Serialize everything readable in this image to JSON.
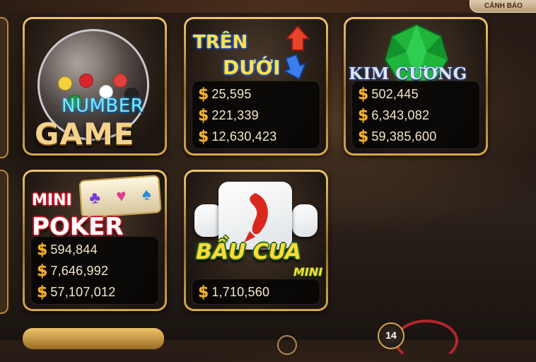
{
  "header": {
    "warning_button": "CẢNH BÁO"
  },
  "games": [
    {
      "id": "number-game",
      "logo_line1": "NUMBER",
      "logo_line2": "GAME",
      "jackpots": []
    },
    {
      "id": "tren-duoi",
      "logo_line1": "TRÊN",
      "logo_line2": "DƯỚI",
      "currency_symbol": "$",
      "jackpots": [
        "25,595",
        "221,339",
        "12,630,423"
      ]
    },
    {
      "id": "kim-cuong",
      "logo_line1": "KIM CƯƠNG",
      "currency_symbol": "$",
      "jackpots": [
        "502,445",
        "6,343,082",
        "59,385,600"
      ]
    },
    {
      "id": "mini-poker",
      "logo_line1": "MINI",
      "logo_line2": "POKER",
      "currency_symbol": "$",
      "jackpots": [
        "594,844",
        "7,646,992",
        "57,107,012"
      ]
    },
    {
      "id": "bau-cua",
      "logo_line1": "BẦU CUA",
      "logo_line2": "MINI",
      "currency_symbol": "$",
      "jackpots": [
        "1,710,560"
      ]
    }
  ],
  "badge": {
    "count": "14"
  },
  "icons": {
    "poker_reel_symbols": [
      "♣",
      "♥",
      "♠"
    ],
    "dollar_color": "#f2b12c"
  }
}
